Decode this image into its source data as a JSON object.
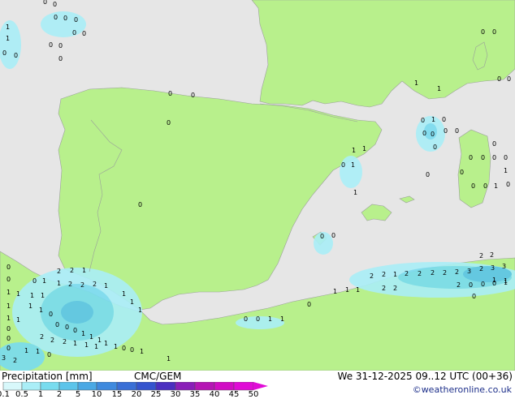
{
  "legend": {
    "title": "Precipitation [mm]",
    "model": "CMC/GEM",
    "valid": "We 31-12-2025 09..12 UTC (00+36)",
    "credit": "©weatheronline.co.uk",
    "ticks": [
      "0.1",
      "0.5",
      "1",
      "2",
      "5",
      "10",
      "15",
      "20",
      "25",
      "30",
      "35",
      "40",
      "45",
      "50"
    ],
    "colors": [
      "#d8f8fb",
      "#aaeef7",
      "#79dcef",
      "#5cc4ea",
      "#4aa8e4",
      "#3f8ade",
      "#3a6fd6",
      "#3554ce",
      "#4b2fc0",
      "#8a1fb8",
      "#b516b4",
      "#d10dc4",
      "#e00bd6"
    ]
  },
  "map": {
    "sea_color": "#e6e6e6",
    "land_color": "#b8f08c",
    "value_labels": [
      "0",
      "0",
      "0",
      "0",
      "0",
      "0",
      "0",
      "1",
      "1",
      "0",
      "0",
      "0",
      "0",
      "0",
      "0",
      "0",
      "0",
      "1",
      "1",
      "0",
      "1",
      "1",
      "0",
      "0",
      "0",
      "1",
      "0",
      "0",
      "0",
      "0",
      "0",
      "0",
      "0",
      "0",
      "0",
      "0",
      "0",
      "0",
      "0",
      "0",
      "0",
      "1",
      "0",
      "1",
      "1",
      "1",
      "0",
      "0",
      "0",
      "0",
      "0",
      "0",
      "1",
      "1",
      "1",
      "1",
      "1",
      "2",
      "2",
      "1",
      "1",
      "2",
      "2",
      "2",
      "1",
      "1",
      "1",
      "1",
      "1",
      "1",
      "1",
      "1",
      "1",
      "0",
      "0",
      "0",
      "0",
      "1",
      "1",
      "1",
      "1",
      "1",
      "0",
      "0",
      "1",
      "1",
      "2",
      "2",
      "2",
      "1",
      "1",
      "1",
      "1",
      "1",
      "0",
      "3",
      "2",
      "2",
      "2",
      "1",
      "2",
      "2",
      "2",
      "2",
      "2",
      "3",
      "2",
      "3",
      "3",
      "1",
      "1",
      "2",
      "2",
      "2",
      "2",
      "2",
      "0",
      "0",
      "0",
      "1",
      "1",
      "1",
      "1",
      "0",
      "0",
      "1",
      "1",
      "0",
      "0",
      "0",
      "0",
      "0",
      "0",
      "0"
    ]
  }
}
